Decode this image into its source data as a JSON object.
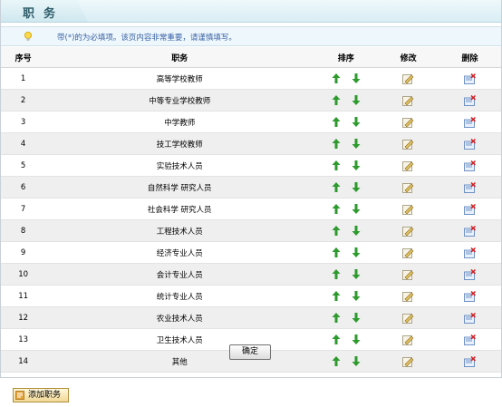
{
  "header": {
    "title": "职务"
  },
  "notice": {
    "text": "带(*)的为必填项。该页内容非常重要，请谨慎填写。"
  },
  "table": {
    "headers": {
      "no": "序号",
      "name": "职务",
      "sort": "排序",
      "edit": "修改",
      "del": "删除"
    },
    "rows": [
      {
        "no": "1",
        "name": "高等学校教师"
      },
      {
        "no": "2",
        "name": "中等专业学校教师"
      },
      {
        "no": "3",
        "name": "中学教师"
      },
      {
        "no": "4",
        "name": "技工学校教师"
      },
      {
        "no": "5",
        "name": "实验技术人员"
      },
      {
        "no": "6",
        "name": "自然科学  研究人员"
      },
      {
        "no": "7",
        "name": "社会科学  研究人员"
      },
      {
        "no": "8",
        "name": "工程技术人员"
      },
      {
        "no": "9",
        "name": "经济专业人员"
      },
      {
        "no": "10",
        "name": "会计专业人员"
      },
      {
        "no": "11",
        "name": "统计专业人员"
      },
      {
        "no": "12",
        "name": "农业技术人员"
      },
      {
        "no": "13",
        "name": "卫生技术人员"
      },
      {
        "no": "14",
        "name": "其他"
      }
    ]
  },
  "buttons": {
    "ok": "确定",
    "add": "添加职务"
  },
  "icons": {
    "up": "arrow-up-icon",
    "down": "arrow-down-icon",
    "edit": "edit-icon",
    "del": "delete-icon",
    "tip": "lightbulb-icon"
  },
  "colors": {
    "arrow": "#2e9b2e",
    "header_text": "#2f5d6b",
    "notice_text": "#3a63a8",
    "row_alt": "#efefef"
  }
}
